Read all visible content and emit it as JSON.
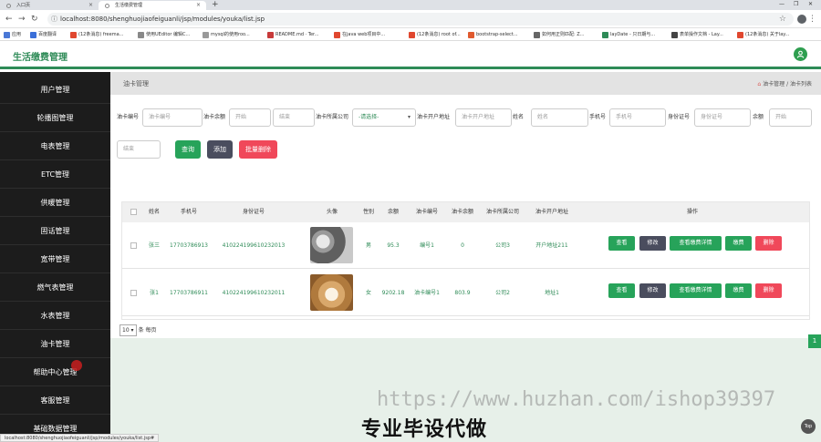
{
  "browser": {
    "tabs": [
      {
        "label": "入口页"
      },
      {
        "label": "生活缴费管理"
      }
    ],
    "new_tab": "+",
    "url": "localhost:8080/shenghuojiaofeiguanli/jsp/modules/youka/list.jsp",
    "bookmarks": [
      {
        "label": "应用",
        "color": "#4a78d6"
      },
      {
        "label": "百度翻译",
        "color": "#3b6fd8"
      },
      {
        "label": "(12条消息) freema...",
        "color": "#e0472f"
      },
      {
        "label": "使用UEditor 编辑C...",
        "color": "#888888"
      },
      {
        "label": "mysql的使用roo...",
        "color": "#999999"
      },
      {
        "label": "README.md · Ter...",
        "color": "#c73a3a"
      },
      {
        "label": "在java web项目中...",
        "color": "#e0472f"
      },
      {
        "label": "(12条消息) root of...",
        "color": "#e0472f"
      },
      {
        "label": "bootstrap-select...",
        "color": "#e05a2f"
      },
      {
        "label": "如何用正则匹配: Z...",
        "color": "#666666"
      },
      {
        "label": "layDate - 只日期与...",
        "color": "#2e8b57"
      },
      {
        "label": "表单操作文档 - Lay...",
        "color": "#444444"
      },
      {
        "label": "(12条消息) 关于lay...",
        "color": "#e0472f"
      }
    ]
  },
  "app": {
    "title": "生活缴费管理",
    "avatar_icon": "user-icon"
  },
  "sidebar": {
    "items": [
      {
        "label": "用户管理"
      },
      {
        "label": "轮播图管理"
      },
      {
        "label": "电表管理"
      },
      {
        "label": "ETC管理"
      },
      {
        "label": "供暖管理"
      },
      {
        "label": "固话管理"
      },
      {
        "label": "宽带管理"
      },
      {
        "label": "燃气表管理"
      },
      {
        "label": "水表管理"
      },
      {
        "label": "油卡管理"
      },
      {
        "label": "帮助中心管理"
      },
      {
        "label": "客服管理"
      },
      {
        "label": "基础数据管理"
      }
    ]
  },
  "page": {
    "title": "油卡管理",
    "breadcrumb": "油卡管理 / 油卡列表"
  },
  "filters": {
    "card_no_label": "油卡编号",
    "card_no_placeholder": "油卡编号",
    "balance_label": "油卡余额",
    "balance_start_placeholder": "开始",
    "balance_end_placeholder": "结束",
    "company_label": "油卡所属公司",
    "company_value": "-请选择-",
    "address_label": "油卡开户地址",
    "address_placeholder": "油卡开户地址",
    "name_label": "姓名",
    "name_placeholder": "姓名",
    "phone_label": "手机号",
    "phone_placeholder": "手机号",
    "idcard_label": "身份证号",
    "idcard_placeholder": "身份证号",
    "yue_label": "余额",
    "yue_start_placeholder": "开始",
    "yue_end_placeholder": "结束"
  },
  "buttons": {
    "query": "查询",
    "add": "添加",
    "batch_delete": "批量删除"
  },
  "table": {
    "headers": [
      "姓名",
      "手机号",
      "身份证号",
      "头像",
      "性别",
      "余额",
      "油卡编号",
      "油卡余额",
      "油卡所属公司",
      "油卡开户地址",
      "操作"
    ],
    "rows": [
      {
        "name": "张三",
        "phone": "17703786913",
        "idcard": "410224199610232013",
        "gender": "男",
        "balance": "95.3",
        "card_no": "编号1",
        "card_balance": "0",
        "company": "公司3",
        "address": "开户地址211"
      },
      {
        "name": "张1",
        "phone": "17703786911",
        "idcard": "410224199610232011",
        "gender": "女",
        "balance": "9202.18",
        "card_no": "油卡编号1",
        "card_balance": "803.9",
        "company": "公司2",
        "address": "地址1"
      }
    ],
    "actions": {
      "view": "查看",
      "edit": "修改",
      "detail": "查看缴费详情",
      "pay": "缴费",
      "delete": "删除"
    }
  },
  "pager": {
    "page_size": "10",
    "per_page_text": "条 每页",
    "current_page": "1"
  },
  "overlay": {
    "watermark": "https://www.huzhan.com/ishop39397",
    "caption": "专业毕设代做",
    "top_button": "Top"
  },
  "status_url": "localhost:8080/shenghuojiaofeiguanli/jsp/modules/youka/list.jsp#"
}
